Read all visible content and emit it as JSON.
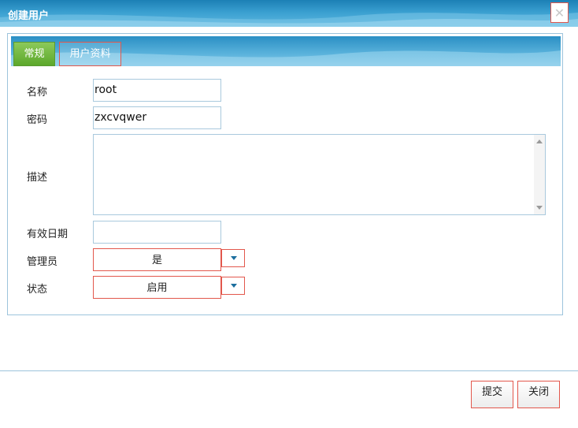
{
  "dialog": {
    "title": "创建用户",
    "close_icon": "close-icon"
  },
  "tabs": [
    {
      "label": "常规",
      "active": true
    },
    {
      "label": "用户资料",
      "active": false
    }
  ],
  "form": {
    "name_label": "名称",
    "name_value": "root",
    "password_label": "密码",
    "password_value": "zxcvqwer",
    "description_label": "描述",
    "description_value": "",
    "expiry_label": "有效日期",
    "expiry_value": "",
    "admin_label": "管理员",
    "admin_value": "是",
    "status_label": "状态",
    "status_value": "启用"
  },
  "buttons": {
    "submit_label": "提交",
    "close_label": "关闭"
  },
  "colors": {
    "header_blue": "#3a9fd0",
    "tab_active_green": "#6db43a",
    "focus_red": "#e2574c",
    "border_blue": "#a9c9dd"
  }
}
